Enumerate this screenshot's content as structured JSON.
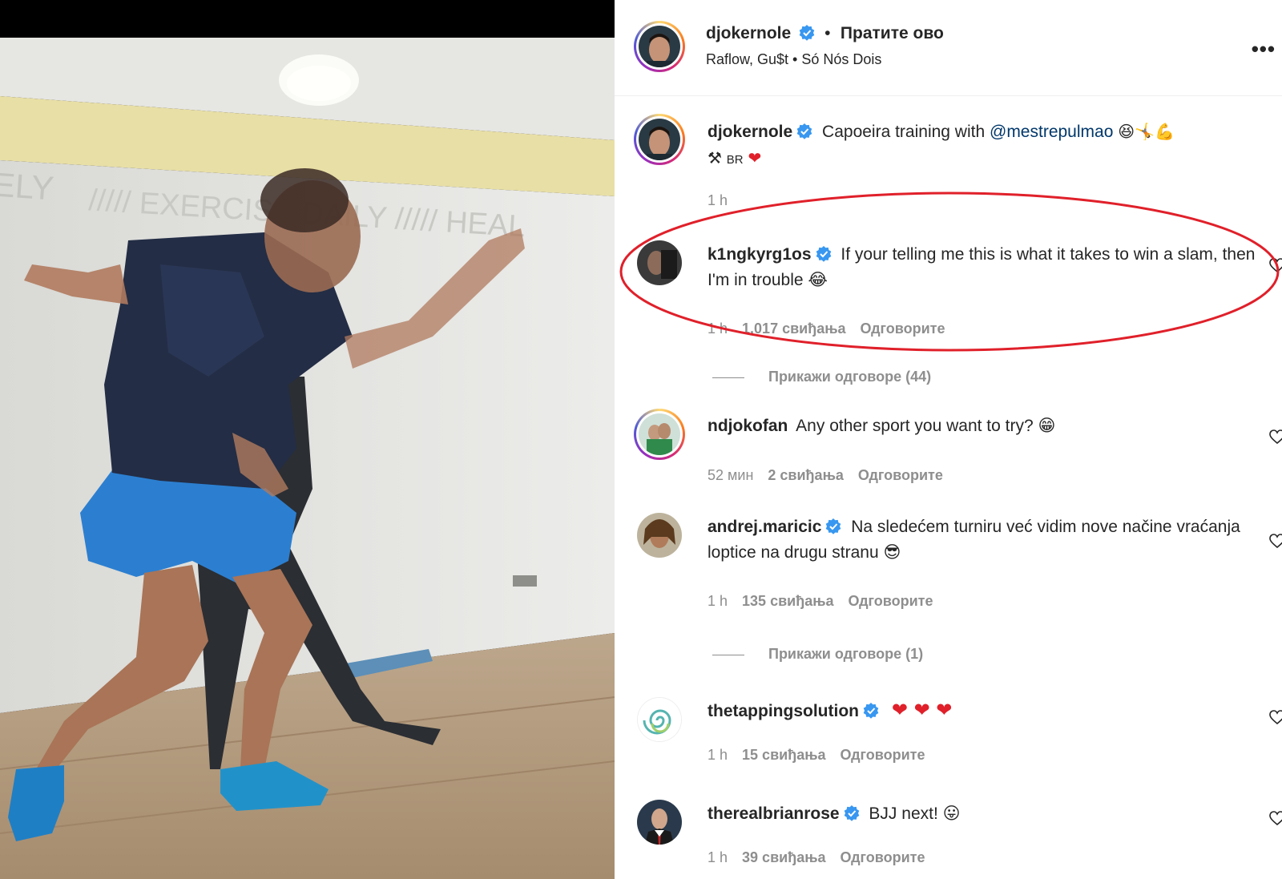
{
  "header": {
    "username": "djokernole",
    "separator": "•",
    "follow_label": "Пратите ово",
    "audio": "Raflow, Gu$t • Só Nós Dois"
  },
  "caption": {
    "username": "djokernole",
    "text": "Capoeira training with ",
    "mention": "@mestrepulmao",
    "emojis": "😆🤸💪",
    "line2_emoji": "⚒",
    "line2_text": "BR",
    "heart": "❤",
    "time": "1 h"
  },
  "comments": [
    {
      "username": "k1ngkyrg1os",
      "verified": true,
      "text": "If your telling me this is what it takes to win a slam, then I'm in trouble 😂",
      "time": "1 h",
      "likes": "1.017 свиђања",
      "reply": "Одговорите",
      "view_replies": "Прикажи одговоре (44)"
    },
    {
      "username": "ndjokofan",
      "verified": false,
      "text": "Any other sport you want to try? 😁",
      "time": "52 мин",
      "likes": "2 свиђања",
      "reply": "Одговорите"
    },
    {
      "username": "andrej.maricic",
      "verified": true,
      "text": "Na sledećem turniru već vidim nove načine vraćanja loptice na drugu stranu 😎",
      "time": "1 h",
      "likes": "135 свиђања",
      "reply": "Одговорите",
      "view_replies": "Прикажи одговоре (1)"
    },
    {
      "username": "thetappingsolution",
      "verified": true,
      "text": "❤ ❤ ❤",
      "time": "1 h",
      "likes": "15 свиђања",
      "reply": "Одговорите"
    },
    {
      "username": "therealbrianrose",
      "verified": true,
      "text": "BJJ next! 😛",
      "time": "1 h",
      "likes": "39 свиђања",
      "reply": "Одговорите"
    }
  ],
  "video": {
    "wall_text_1": "ELY",
    "wall_text_2": "///// EXERCISE DAILY ///// HEAL"
  },
  "colors": {
    "verified": "#3897f0",
    "annotation": "#e0202a",
    "muted": "#8e8e8e",
    "text": "#262626"
  },
  "icons": [
    "verified-badge-icon",
    "more-options-icon",
    "heart-icon"
  ]
}
